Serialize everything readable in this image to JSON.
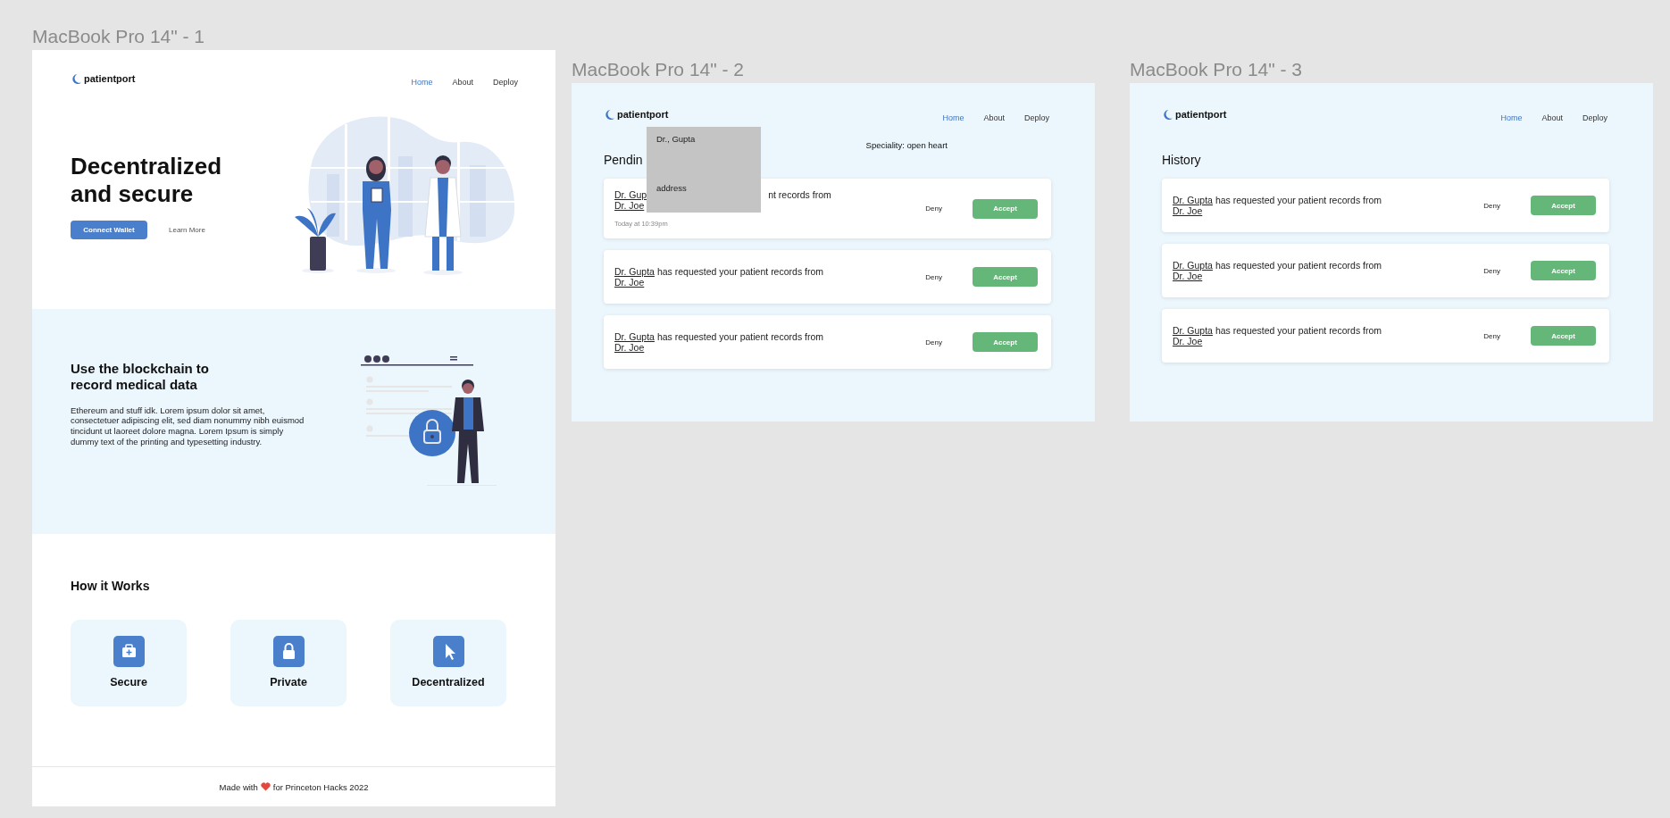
{
  "frames": [
    {
      "kind": "landing",
      "title": "MacBook Pro 14\" - 1",
      "logo": "patientport",
      "nav": [
        {
          "label": "Home",
          "selected": true
        },
        {
          "label": "About",
          "selected": false
        },
        {
          "label": "Deploy",
          "selected": false
        }
      ],
      "hero": {
        "heading": "Decentralized and secure",
        "primary_button": "Connect Wallet",
        "secondary_link": "Learn More"
      },
      "about": {
        "heading": "Use the blockchain to record medical data",
        "body": "Ethereum and stuff idk. Lorem ipsum dolor sit amet, consectetuer adipiscing elit, sed diam nonummy nibh euismod tincidunt ut laoreet dolore magna. Lorem Ipsum is simply dummy text of the printing and typesetting industry."
      },
      "how": {
        "heading": "How it Works",
        "features": [
          {
            "label": "Secure"
          },
          {
            "label": "Private"
          },
          {
            "label": "Decentralized"
          }
        ]
      },
      "footer": {
        "before": "Made with",
        "after": "for Princeton Hacks 2022"
      }
    },
    {
      "kind": "requests",
      "title": "MacBook Pro 14\" - 2",
      "logo": "patientport",
      "nav": [
        {
          "label": "Home",
          "selected": true
        },
        {
          "label": "About",
          "selected": false
        },
        {
          "label": "Deploy",
          "selected": false
        }
      ],
      "heading": "Pendin",
      "speciality": "Speciality: open heart",
      "popup": {
        "name": "Dr., Gupta",
        "address": "address"
      },
      "requests": [
        {
          "obscured": true,
          "requester": "Dr. Gup",
          "message": "nt records from",
          "patient": "Dr. Joe",
          "time": "Today at 10:39pm",
          "deny": "Deny",
          "accept": "Accept"
        },
        {
          "obscured": false,
          "requester": "Dr. Gupta",
          "message": "has requested your patient records from",
          "patient": "Dr. Joe",
          "deny": "Deny",
          "accept": "Accept"
        },
        {
          "obscured": false,
          "requester": "Dr. Gupta",
          "message": "has requested your patient records from",
          "patient": "Dr. Joe",
          "deny": "Deny",
          "accept": "Accept"
        }
      ]
    },
    {
      "kind": "requests",
      "title": "MacBook Pro 14\" - 3",
      "logo": "patientport",
      "nav": [
        {
          "label": "Home",
          "selected": true
        },
        {
          "label": "About",
          "selected": false
        },
        {
          "label": "Deploy",
          "selected": false
        }
      ],
      "heading": "History",
      "requests": [
        {
          "obscured": false,
          "requester": "Dr. Gupta",
          "message": "has requested your patient records from",
          "patient": "Dr. Joe",
          "deny": "Deny",
          "accept": "Accept"
        },
        {
          "obscured": false,
          "requester": "Dr. Gupta",
          "message": "has requested your patient records from",
          "patient": "Dr. Joe",
          "deny": "Deny",
          "accept": "Accept"
        },
        {
          "obscured": false,
          "requester": "Dr. Gupta",
          "message": "has requested your patient records from",
          "patient": "Dr. Joe",
          "deny": "Deny",
          "accept": "Accept"
        }
      ]
    }
  ]
}
